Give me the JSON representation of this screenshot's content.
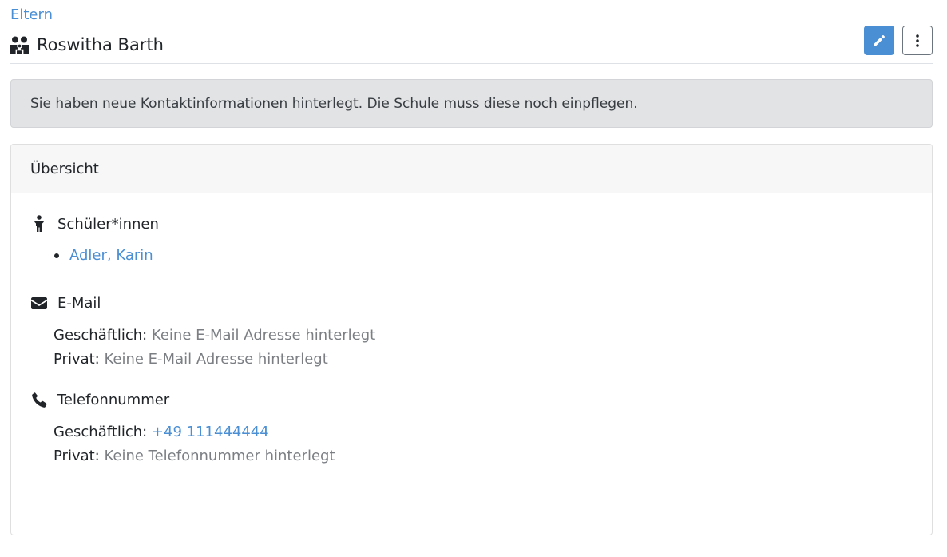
{
  "breadcrumb": {
    "parent": "Eltern"
  },
  "header": {
    "title": "Roswitha Barth"
  },
  "alert": {
    "text": "Sie haben neue Kontaktinformationen hinterlegt. Die Schule muss diese noch einpflegen."
  },
  "card": {
    "header": "Übersicht",
    "students": {
      "heading": "Schüler*innen",
      "items": [
        "Adler, Karin"
      ]
    },
    "email": {
      "heading": "E-Mail",
      "business_label": "Geschäftlich:",
      "business_value": "Keine E-Mail Adresse hinterlegt",
      "private_label": "Privat:",
      "private_value": "Keine E-Mail Adresse hinterlegt"
    },
    "phone": {
      "heading": "Telefonnummer",
      "business_label": "Geschäftlich:",
      "business_value": "+49 111444444",
      "private_label": "Privat:",
      "private_value": "Keine Telefonnummer hinterlegt"
    }
  },
  "icons": {
    "title": "users-icon",
    "edit": "pencil-icon",
    "more": "kebab-menu-icon",
    "students": "child-icon",
    "email": "envelope-icon",
    "phone": "phone-icon"
  },
  "colors": {
    "accent": "#4a8fd4",
    "alert_bg": "#e2e3e5",
    "muted_text": "#7b7f84"
  }
}
